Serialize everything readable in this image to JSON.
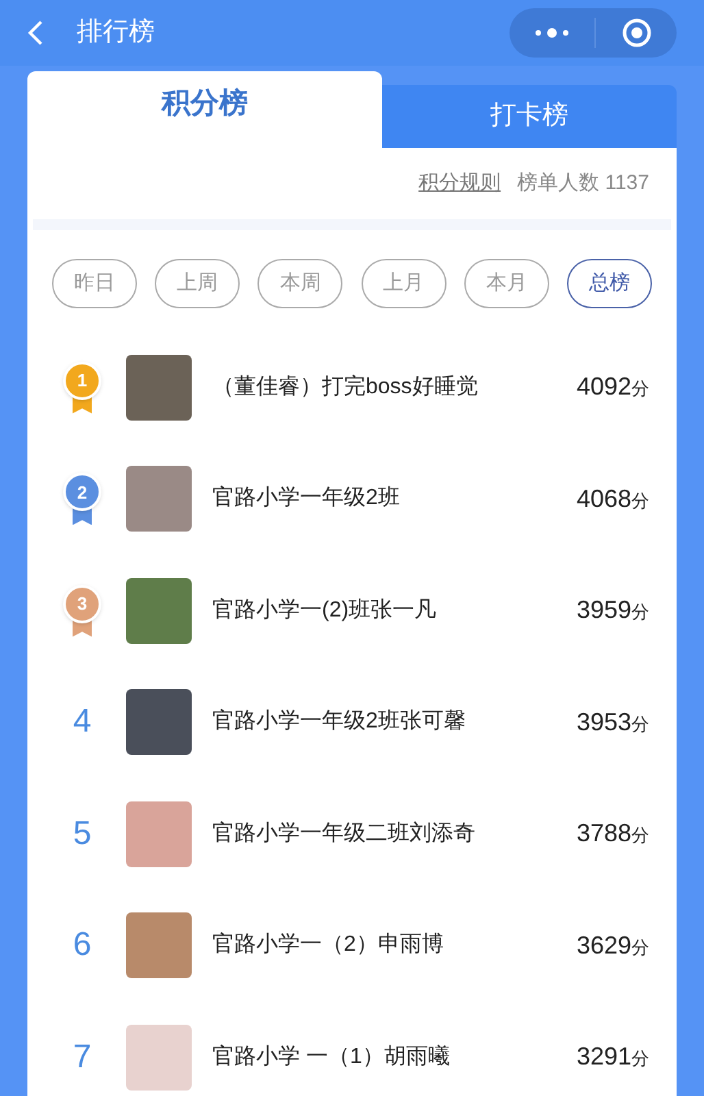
{
  "header": {
    "title": "排行榜"
  },
  "tabs": [
    {
      "label": "积分榜",
      "selected": true
    },
    {
      "label": "打卡榜",
      "selected": false
    }
  ],
  "info": {
    "rules_link": "积分规则",
    "count_label": "榜单人数 1137"
  },
  "periods": [
    {
      "label": "昨日",
      "selected": false
    },
    {
      "label": "上周",
      "selected": false
    },
    {
      "label": "本周",
      "selected": false
    },
    {
      "label": "上月",
      "selected": false
    },
    {
      "label": "本月",
      "selected": false
    },
    {
      "label": "总榜",
      "selected": true
    }
  ],
  "rows": [
    {
      "rank": "1",
      "kind": "medal",
      "color": "#f2a81d",
      "name": "（董佳睿）打完boss好睡觉",
      "score": "4092",
      "unit": "分"
    },
    {
      "rank": "2",
      "kind": "medal",
      "color": "#5b8fe0",
      "name": "官路小学一年级2班",
      "score": "4068",
      "unit": "分"
    },
    {
      "rank": "3",
      "kind": "medal",
      "color": "#e0a27a",
      "name": "官路小学一(2)班张一凡",
      "score": "3959",
      "unit": "分"
    },
    {
      "rank": "4",
      "kind": "number",
      "name": "官路小学一年级2班张可馨",
      "score": "3953",
      "unit": "分"
    },
    {
      "rank": "5",
      "kind": "number",
      "name": "官路小学一年级二班刘添奇",
      "score": "3788",
      "unit": "分"
    },
    {
      "rank": "6",
      "kind": "number",
      "name": "官路小学一（2）申雨博",
      "score": "3629",
      "unit": "分"
    },
    {
      "rank": "7",
      "kind": "number",
      "name": "官路小学 一（1）胡雨曦",
      "score": "3291",
      "unit": "分"
    }
  ]
}
